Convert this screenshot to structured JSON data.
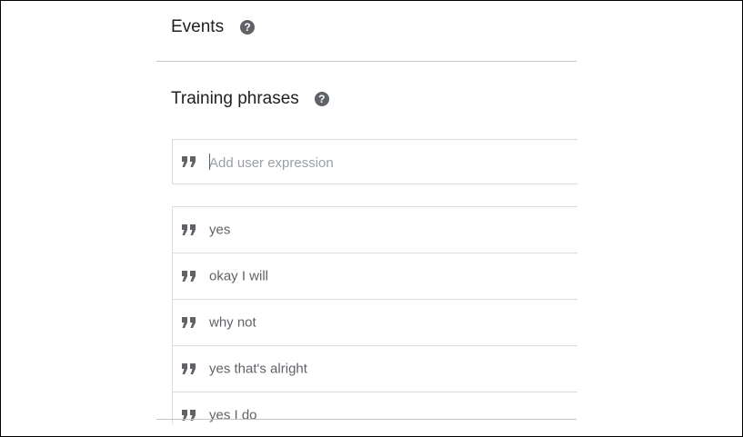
{
  "events": {
    "title": "Events",
    "help_icon": "help-circle-icon"
  },
  "training_phrases": {
    "title": "Training phrases",
    "help_icon": "help-circle-icon",
    "input": {
      "placeholder": "Add user expression",
      "value": "",
      "icon": "quote-icon"
    },
    "phrases": [
      {
        "text": "yes",
        "icon": "quote-icon"
      },
      {
        "text": "okay I will",
        "icon": "quote-icon"
      },
      {
        "text": "why not",
        "icon": "quote-icon"
      },
      {
        "text": "yes that's alright",
        "icon": "quote-icon"
      },
      {
        "text": "yes I do",
        "icon": "quote-icon"
      }
    ]
  },
  "colors": {
    "text_primary": "#202124",
    "text_secondary": "#5f6368",
    "placeholder": "#9aa0a6",
    "border": "#dadce0",
    "icon": "#5f6368"
  }
}
